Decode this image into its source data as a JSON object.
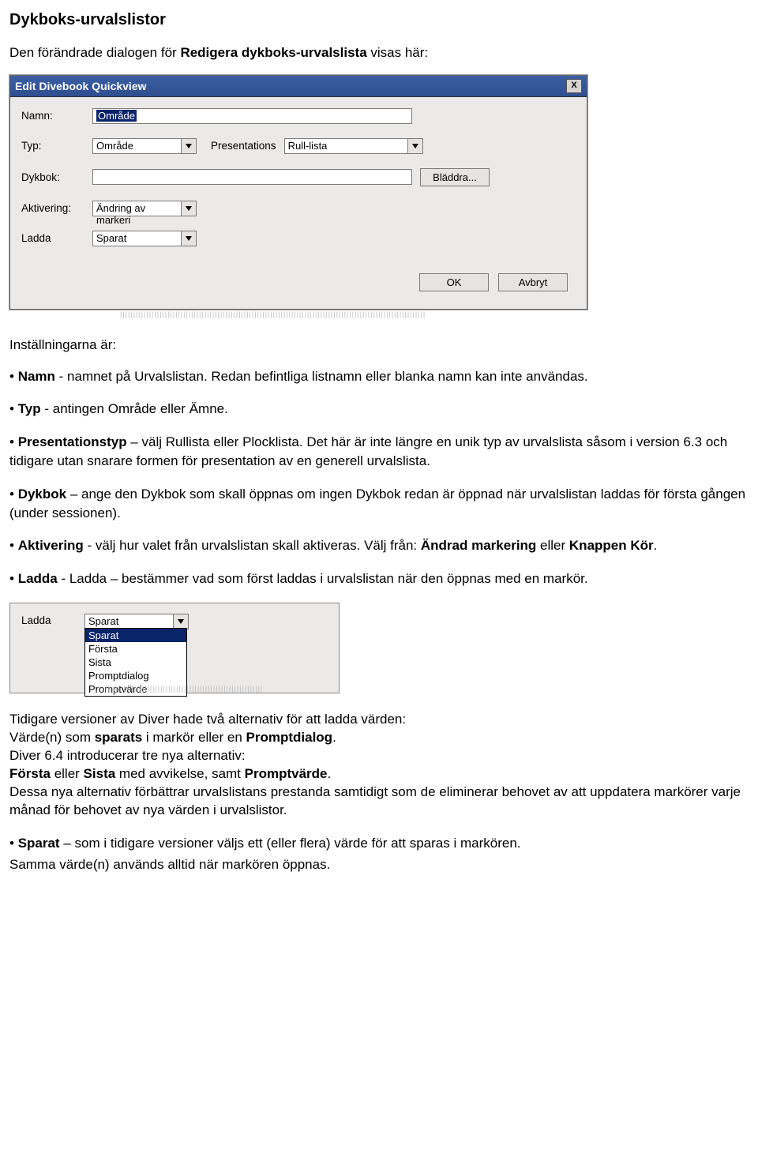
{
  "heading": "Dykboks-urvalslistor",
  "intro": {
    "a": "Den förändrade dialogen för ",
    "b": "Redigera dykboks-urvalslista",
    "c": " visas här:"
  },
  "dialog": {
    "title": "Edit Divebook Quickview",
    "close": "X",
    "rows": {
      "namn_label": "Namn:",
      "namn_value": "Område",
      "typ_label": "Typ:",
      "typ_value": "Område",
      "pres_label": "Presentations",
      "pres_value": "Rull-lista",
      "dykbok_label": "Dykbok:",
      "dykbok_value": "",
      "browse_label": "Bläddra...",
      "akt_label": "Aktivering:",
      "akt_value": "Ändring av markeri",
      "ladda_label": "Ladda",
      "ladda_value": "Sparat"
    },
    "buttons": {
      "ok": "OK",
      "cancel": "Avbryt"
    }
  },
  "settings_lead": "Inställningarna är:",
  "bullets1": {
    "namn": {
      "a": "Namn",
      "b": " - namnet på Urvalslistan. Redan befintliga listnamn eller blanka namn kan inte användas."
    },
    "typ": {
      "a": "Typ",
      "b": " - antingen Område eller Ämne."
    },
    "pres": {
      "a": "Presentationstyp",
      "b": " – välj Rullista eller Plocklista. Det här är inte längre en unik typ av urvalslista såsom i version 6.3 och tidigare utan snarare formen för presentation av en generell urvalslista."
    },
    "dykbok": {
      "a": "Dykbok",
      "b": " – ange den Dykbok som skall öppnas om ingen Dykbok redan är öppnad när urvalslistan laddas för första gången (under sessionen)."
    },
    "akt": {
      "a": "Aktivering",
      "b": " - välj hur valet från urvalslistan skall aktiveras. Välj från: ",
      "c": "Ändrad markering",
      "d": " eller ",
      "e": "Knappen Kör",
      "f": "."
    },
    "ladda": {
      "a": "Ladda",
      "b": " - Ladda – bestämmer vad som först laddas i urvalslistan när den öppnas med en markör."
    }
  },
  "ladda_box": {
    "label": "Ladda",
    "value": "Sparat",
    "options": [
      "Sparat",
      "Första",
      "Sista",
      "Promptdialog",
      "Promptvärde"
    ]
  },
  "after": {
    "line1": "Tidigare versioner av Diver hade två  alternativ för att ladda värden:",
    "line2a": "Värde(n) som ",
    "line2b": "sparats",
    "line2c": " i markör eller en ",
    "line2d": "Promptdialog",
    "line2e": ".",
    "line3": "Diver 6.4 introducerar tre nya alternativ:",
    "line4a": "Första",
    "line4b": " eller ",
    "line4c": "Sista",
    "line4d": " med avvikelse, samt ",
    "line4e": "Promptvärde",
    "line4f": ".",
    "line5": "Dessa nya alternativ förbättrar urvalslistans prestanda samtidigt som de eliminerar behovet av att uppdatera markörer varje månad för behovet av nya värden i urvalslistor."
  },
  "sparat_bullet": {
    "a": "Sparat",
    "b": " – som i tidigare versioner väljs ett (eller flera) värde för att sparas i markören."
  },
  "last_line": "Samma värde(n) används alltid när markören öppnas."
}
